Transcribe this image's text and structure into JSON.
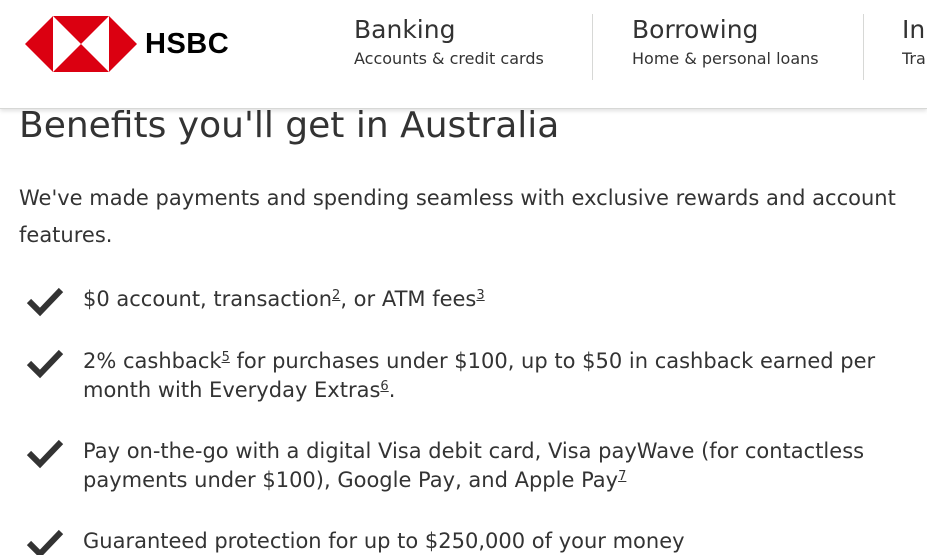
{
  "header": {
    "logo_text": "HSBC",
    "nav": [
      {
        "title": "Banking",
        "subtitle": "Accounts & credit cards"
      },
      {
        "title": "Borrowing",
        "subtitle": "Home & personal loans"
      },
      {
        "title": "In",
        "subtitle": "Tra"
      }
    ]
  },
  "main": {
    "heading": "Benefits you'll get in Australia",
    "intro": "We've made payments and spending seamless with exclusive rewards and account features.",
    "benefits": [
      {
        "parts": [
          "$0 account, transaction",
          ", or ATM fees"
        ],
        "refs": [
          "2",
          "3"
        ]
      },
      {
        "parts": [
          "2% cashback",
          " for purchases under $100, up to $50 in cashback earned per",
          "month  with Everyday Extras",
          "."
        ],
        "refs": [
          "5",
          "6"
        ]
      },
      {
        "parts": [
          "Pay on-the-go with a digital Visa debit card, Visa payWave (for contactless",
          "payments under $100), Google Pay, and Apple Pay"
        ],
        "refs": [
          "7"
        ]
      },
      {
        "parts": [
          "Guaranteed protection for up to $250,000 of your money"
        ]
      }
    ]
  },
  "colors": {
    "brand_red": "#db0011",
    "text": "#333333",
    "check_icon": "#333333"
  },
  "icons": {
    "benefit_marker": "checkmark-icon",
    "logo": "hsbc-hexagon-logo"
  }
}
